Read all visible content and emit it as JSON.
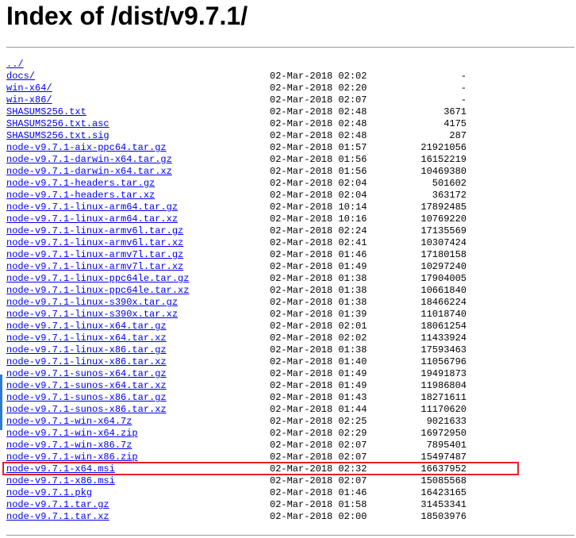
{
  "page": {
    "title": "Index of /dist/v9.7.1/"
  },
  "colors": {
    "link": "#0000ee",
    "highlight_border": "#e8202a",
    "left_accent": "#2e7ad1"
  },
  "entries": [
    {
      "name": "../",
      "date": "",
      "size": ""
    },
    {
      "name": "docs/",
      "date": "02-Mar-2018 02:02",
      "size": "-"
    },
    {
      "name": "win-x64/",
      "date": "02-Mar-2018 02:20",
      "size": "-"
    },
    {
      "name": "win-x86/",
      "date": "02-Mar-2018 02:07",
      "size": "-"
    },
    {
      "name": "SHASUMS256.txt",
      "date": "02-Mar-2018 02:48",
      "size": "3671"
    },
    {
      "name": "SHASUMS256.txt.asc",
      "date": "02-Mar-2018 02:48",
      "size": "4175"
    },
    {
      "name": "SHASUMS256.txt.sig",
      "date": "02-Mar-2018 02:48",
      "size": "287"
    },
    {
      "name": "node-v9.7.1-aix-ppc64.tar.gz",
      "date": "02-Mar-2018 01:57",
      "size": "21921056"
    },
    {
      "name": "node-v9.7.1-darwin-x64.tar.gz",
      "date": "02-Mar-2018 01:56",
      "size": "16152219"
    },
    {
      "name": "node-v9.7.1-darwin-x64.tar.xz",
      "date": "02-Mar-2018 01:56",
      "size": "10469380"
    },
    {
      "name": "node-v9.7.1-headers.tar.gz",
      "date": "02-Mar-2018 02:04",
      "size": "501602"
    },
    {
      "name": "node-v9.7.1-headers.tar.xz",
      "date": "02-Mar-2018 02:04",
      "size": "363172"
    },
    {
      "name": "node-v9.7.1-linux-arm64.tar.gz",
      "date": "02-Mar-2018 10:14",
      "size": "17892485"
    },
    {
      "name": "node-v9.7.1-linux-arm64.tar.xz",
      "date": "02-Mar-2018 10:16",
      "size": "10769220"
    },
    {
      "name": "node-v9.7.1-linux-armv6l.tar.gz",
      "date": "02-Mar-2018 02:24",
      "size": "17135569"
    },
    {
      "name": "node-v9.7.1-linux-armv6l.tar.xz",
      "date": "02-Mar-2018 02:41",
      "size": "10307424"
    },
    {
      "name": "node-v9.7.1-linux-armv7l.tar.gz",
      "date": "02-Mar-2018 01:46",
      "size": "17180158"
    },
    {
      "name": "node-v9.7.1-linux-armv7l.tar.xz",
      "date": "02-Mar-2018 01:49",
      "size": "10297240"
    },
    {
      "name": "node-v9.7.1-linux-ppc64le.tar.gz",
      "date": "02-Mar-2018 01:38",
      "size": "17904005"
    },
    {
      "name": "node-v9.7.1-linux-ppc64le.tar.xz",
      "date": "02-Mar-2018 01:38",
      "size": "10661840"
    },
    {
      "name": "node-v9.7.1-linux-s390x.tar.gz",
      "date": "02-Mar-2018 01:38",
      "size": "18466224"
    },
    {
      "name": "node-v9.7.1-linux-s390x.tar.xz",
      "date": "02-Mar-2018 01:39",
      "size": "11018740"
    },
    {
      "name": "node-v9.7.1-linux-x64.tar.gz",
      "date": "02-Mar-2018 02:01",
      "size": "18061254"
    },
    {
      "name": "node-v9.7.1-linux-x64.tar.xz",
      "date": "02-Mar-2018 02:02",
      "size": "11433924"
    },
    {
      "name": "node-v9.7.1-linux-x86.tar.gz",
      "date": "02-Mar-2018 01:38",
      "size": "17593463"
    },
    {
      "name": "node-v9.7.1-linux-x86.tar.xz",
      "date": "02-Mar-2018 01:40",
      "size": "11056796"
    },
    {
      "name": "node-v9.7.1-sunos-x64.tar.gz",
      "date": "02-Mar-2018 01:49",
      "size": "19491873"
    },
    {
      "name": "node-v9.7.1-sunos-x64.tar.xz",
      "date": "02-Mar-2018 01:49",
      "size": "11986804"
    },
    {
      "name": "node-v9.7.1-sunos-x86.tar.gz",
      "date": "02-Mar-2018 01:43",
      "size": "18271611"
    },
    {
      "name": "node-v9.7.1-sunos-x86.tar.xz",
      "date": "02-Mar-2018 01:44",
      "size": "11170620"
    },
    {
      "name": "node-v9.7.1-win-x64.7z",
      "date": "02-Mar-2018 02:25",
      "size": "9021633"
    },
    {
      "name": "node-v9.7.1-win-x64.zip",
      "date": "02-Mar-2018 02:29",
      "size": "16972950"
    },
    {
      "name": "node-v9.7.1-win-x86.7z",
      "date": "02-Mar-2018 02:07",
      "size": "7895401"
    },
    {
      "name": "node-v9.7.1-win-x86.zip",
      "date": "02-Mar-2018 02:07",
      "size": "15497487"
    },
    {
      "name": "node-v9.7.1-x64.msi",
      "date": "02-Mar-2018 02:32",
      "size": "16637952"
    },
    {
      "name": "node-v9.7.1-x86.msi",
      "date": "02-Mar-2018 02:07",
      "size": "15085568"
    },
    {
      "name": "node-v9.7.1.pkg",
      "date": "02-Mar-2018 01:46",
      "size": "16423165"
    },
    {
      "name": "node-v9.7.1.tar.gz",
      "date": "02-Mar-2018 01:58",
      "size": "31453341"
    },
    {
      "name": "node-v9.7.1.tar.xz",
      "date": "02-Mar-2018 02:00",
      "size": "18503976"
    }
  ]
}
